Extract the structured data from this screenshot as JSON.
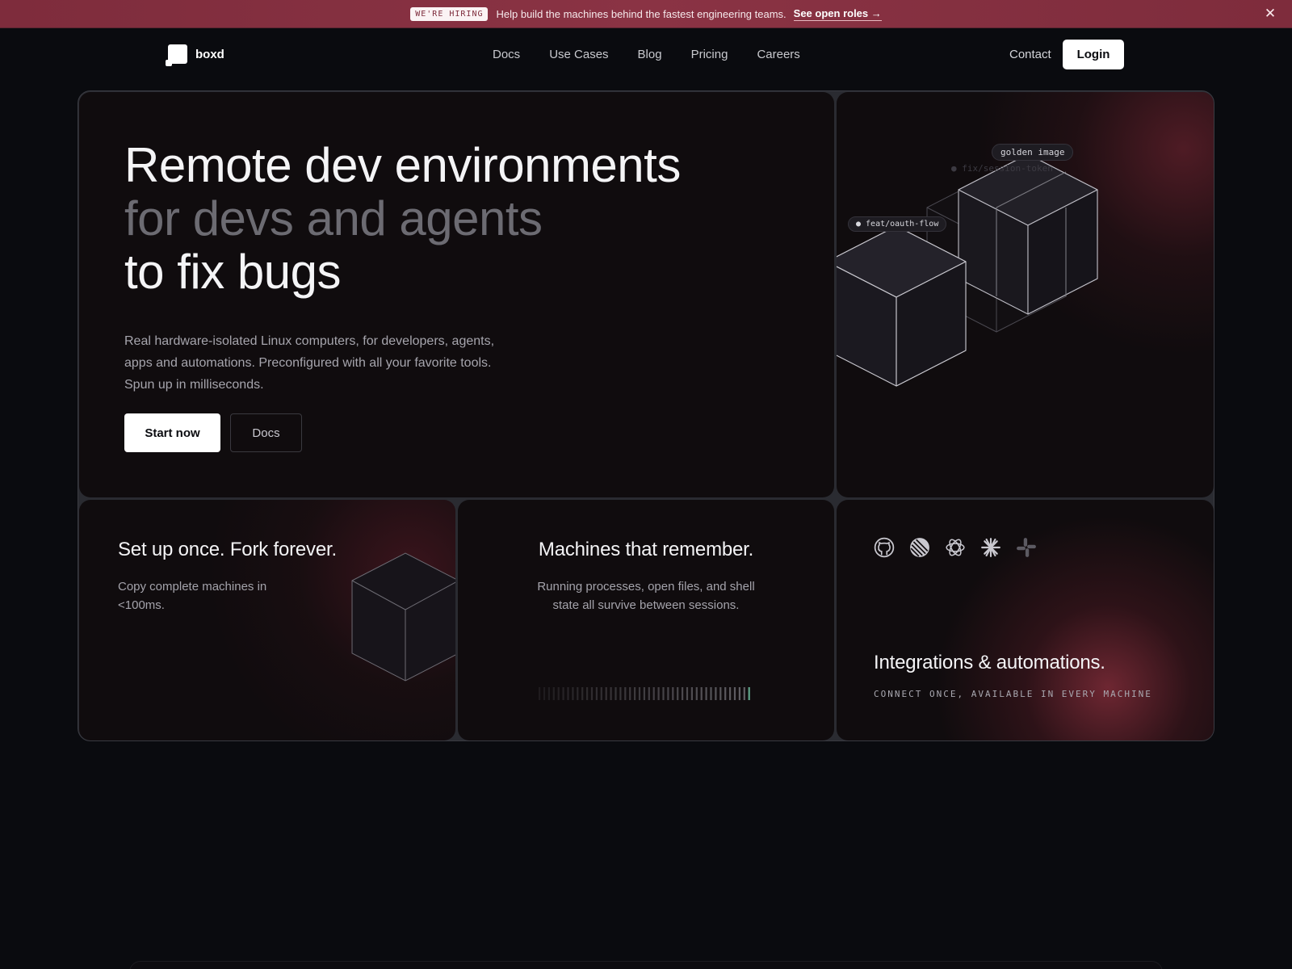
{
  "banner": {
    "badge": "WE'RE HIRING",
    "message": "Help build the machines behind the fastest engineering teams.",
    "link": "See open roles →",
    "close": "✕"
  },
  "nav": {
    "logo_text": "boxd",
    "links": [
      "Docs",
      "Use Cases",
      "Blog",
      "Pricing",
      "Careers"
    ],
    "contact": "Contact",
    "login": "Login"
  },
  "hero": {
    "line1": "Remote dev environments",
    "line2": "for devs and agents",
    "line3": "to fix bugs",
    "description": "Real hardware-isolated Linux computers, for developers, agents, apps and automations. Preconfigured with all your favorite tools. Spun up in milliseconds.",
    "primary_cta": "Start now",
    "secondary_cta": "Docs"
  },
  "hero_viz": {
    "tag_golden": "golden image",
    "tag_faint": "● fix/session-token",
    "tag_branch": "● feat/oauth-flow"
  },
  "cards": [
    {
      "title": "Set up once. Fork forever.",
      "description": "Copy complete machines in <100ms."
    },
    {
      "title": "Machines that remember.",
      "description": "Running processes, open files, and shell state all survive between sessions."
    },
    {
      "title": "Integrations & automations.",
      "caption": "CONNECT ONCE, AVAILABLE IN EVERY MACHINE",
      "icons": [
        "github-icon",
        "linear-icon",
        "openai-icon",
        "claude-icon",
        "slack-icon"
      ]
    }
  ],
  "colors": {
    "accent": "#8a3344",
    "background": "#0a0b0f",
    "card": "#100c0e",
    "progress": "#5fa58a"
  }
}
